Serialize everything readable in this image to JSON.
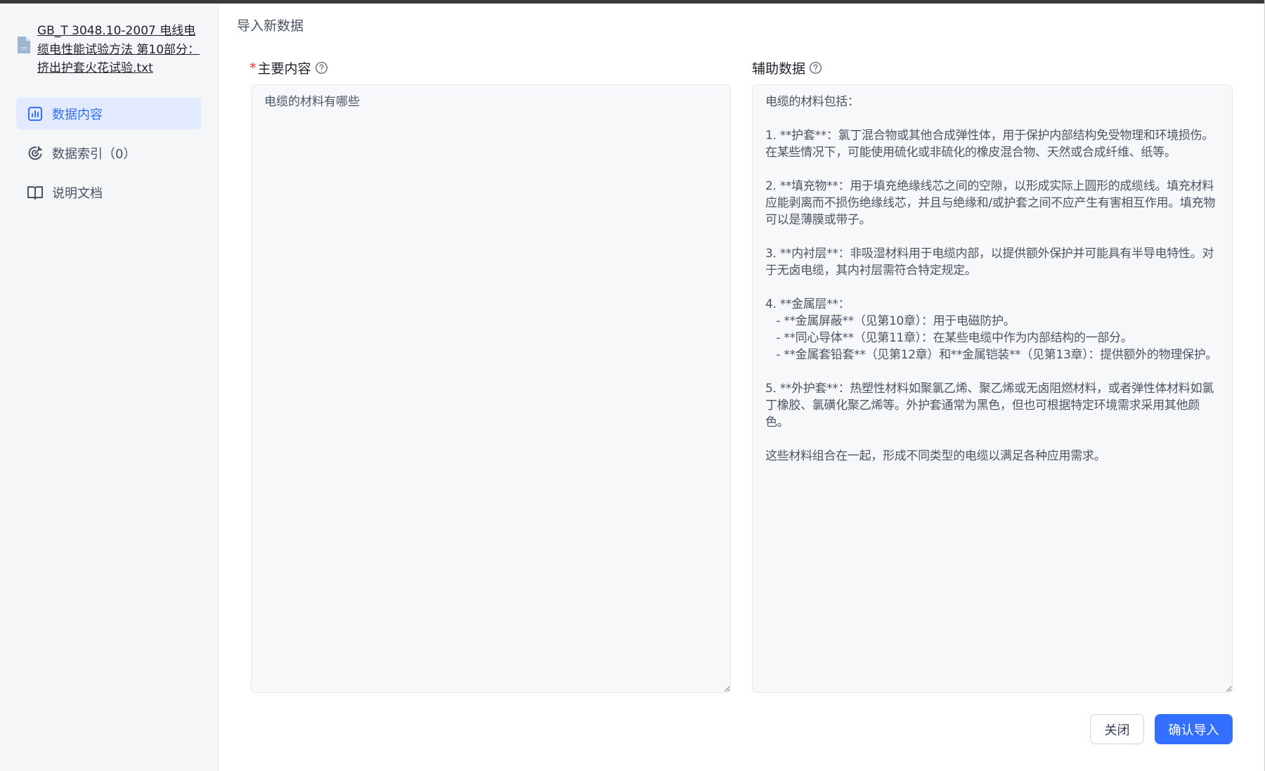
{
  "file": {
    "icon": "txt-file-icon",
    "name": "GB_T 3048.10-2007 电线电缆电性能试验方法 第10部分：挤出护套火花试验.txt"
  },
  "sidebar": {
    "items": [
      {
        "label": "数据内容",
        "icon": "bar-chart-icon",
        "active": true
      },
      {
        "label": "数据索引（0）",
        "icon": "target-icon",
        "active": false
      },
      {
        "label": "说明文档",
        "icon": "book-icon",
        "active": false
      }
    ]
  },
  "dialog": {
    "title": "导入新数据",
    "main_field": {
      "required_mark": "*",
      "label": "主要内容",
      "value": "电缆的材料有哪些"
    },
    "aux_field": {
      "label": "辅助数据",
      "value": "电缆的材料包括：\n\n1. **护套**：氯丁混合物或其他合成弹性体，用于保护内部结构免受物理和环境损伤。在某些情况下，可能使用硫化或非硫化的橡皮混合物、天然或合成纤维、纸等。\n\n2. **填充物**：用于填充绝缘线芯之间的空隙，以形成实际上圆形的成缆线。填充材料应能剥离而不损伤绝缘线芯，并且与绝缘和/或护套之间不应产生有害相互作用。填充物可以是薄膜或带子。\n\n3. **内衬层**：非吸湿材料用于电缆内部，以提供额外保护并可能具有半导电特性。对于无卤电缆，其内衬层需符合特定规定。\n\n4. **金属层**：\n   - **金属屏蔽**（见第10章）：用于电磁防护。\n   - **同心导体**（见第11章）：在某些电缆中作为内部结构的一部分。\n   - **金属套铅套**（见第12章）和**金属铠装**（见第13章）：提供额外的物理保护。\n\n5. **外护套**：热塑性材料如聚氯乙烯、聚乙烯或无卤阻燃材料，或者弹性体材料如氯丁橡胶、氯磺化聚乙烯等。外护套通常为黑色，但也可根据特定环境需求采用其他颜色。\n\n这些材料组合在一起，形成不同类型的电缆以满足各种应用需求。"
    },
    "close_label": "关闭",
    "confirm_label": "确认导入"
  },
  "colors": {
    "accent": "#3370ff",
    "active_bg": "#e1eaff",
    "required": "#f5222d",
    "sidebar_bg": "#f4f6f8"
  }
}
